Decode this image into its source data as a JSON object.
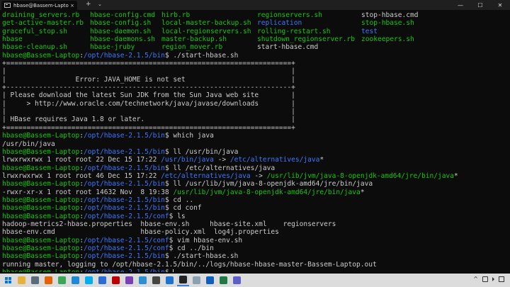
{
  "window": {
    "tab_title": "hbase@Bassem-Laptop: /opt/hl",
    "tab_close": "×",
    "new_tab": "+",
    "dropdown": "⌄",
    "minimize": "—",
    "maximize": "☐",
    "close": "✕"
  },
  "terminal": {
    "file_grid": [
      [
        "draining_servers.rb",
        "hbase-config.cmd",
        "hirb.rb",
        "regionservers.sh",
        "stop-hbase.cmd"
      ],
      [
        "get-active-master.rb",
        "hbase-config.sh",
        "local-master-backup.sh",
        "replication",
        "stop-hbase.sh"
      ],
      [
        "graceful_stop.sh",
        "hbase-daemon.sh",
        "local-regionservers.sh",
        "rolling-restart.sh",
        "test"
      ],
      [
        "hbase",
        "hbase-daemons.sh",
        "master-backup.sh",
        "shutdown_regionserver.rb",
        "zookeepers.sh"
      ],
      [
        "hbase-cleanup.sh",
        "hbase-jruby",
        "region_mover.rb",
        "start-hbase.cmd",
        ""
      ]
    ],
    "prompt_user": "hbase@Bassem-Laptop",
    "prompt_sep": ":",
    "prompt_bin": "/opt/hbase-2.1.5/bin",
    "prompt_conf": "/opt/hbase-2.1.5/conf",
    "prompt_end": "$",
    "cmd_start": " ./start-hbase.sh",
    "box_border": "+======================================================================+",
    "box_blank": "|                                                                      |",
    "box_error": "|                 Error: JAVA_HOME is not set                          |",
    "box_sep": "+----------------------------------------------------------------------+",
    "box_download": "| Please download the latest Sun JDK from the Sun Java web site        |",
    "box_url": "|     > http://www.oracle.com/technetwork/java/javase/downloads        |",
    "box_blank2": "|                                                                      |",
    "box_requires": "| HBase requires Java 1.8 or later.                                    |",
    "cmd_which": " which java",
    "out_which": "/usr/bin/java",
    "cmd_ll1": " ll /usr/bin/java",
    "ll1_prefix": "lrwxrwxrwx 1 root root 22 Dec 15 17:22 ",
    "ll1_link": "/usr/bin/java",
    "ll1_arrow": " -> ",
    "ll1_target": "/etc/alternatives/java",
    "ll1_star": "*",
    "cmd_ll2": " ll /etc/alternatives/java",
    "ll2_prefix": "lrwxrwxrwx 1 root root 46 Dec 15 17:22 ",
    "ll2_link": "/etc/alternatives/java",
    "ll2_arrow": " -> ",
    "ll2_target": "/usr/lib/jvm/java-8-openjdk-amd64/jre/bin/java",
    "ll2_star": "*",
    "cmd_ll3": " ll /usr/lib/jvm/java-8-openjdk-amd64/jre/bin/java",
    "ll3_prefix": "-rwxr-xr-x 1 root root 14632 Nov  8 19:38 ",
    "ll3_target": "/usr/lib/jvm/java-8-openjdk-amd64/jre/bin/java",
    "ll3_star": "*",
    "cmd_cd": " cd ..",
    "cmd_cdconf": " cd conf",
    "cmd_ls": " ls",
    "ls_row1": "hadoop-metrics2-hbase.properties  hbase-env.sh     hbase-site.xml    regionservers",
    "ls_row2": "hbase-env.cmd                     hbase-policy.xml  log4j.properties",
    "cmd_vim": " vim hbase-env.sh",
    "cmd_cdbin": " cd ../bin",
    "cmd_start2": " ./start-hbase.sh",
    "out_running": "running master, logging to /opt/hbase-2.1.5/bin/../logs/hbase-hbase-master-Bassem-Laptop.out"
  },
  "taskbar": {
    "icons": [
      {
        "name": "file-explorer-icon",
        "color": "#e8b23a",
        "active": false
      },
      {
        "name": "store-icon",
        "color": "#5a6b7a",
        "active": false
      },
      {
        "name": "firefox-icon",
        "color": "#e66000",
        "active": false
      },
      {
        "name": "chrome-icon",
        "color": "#3aa757",
        "active": false
      },
      {
        "name": "edge-icon",
        "color": "#1e8ad6",
        "active": false
      },
      {
        "name": "skype-icon",
        "color": "#00aff0",
        "active": false
      },
      {
        "name": "maps-icon",
        "color": "#2b6cd6",
        "active": false
      },
      {
        "name": "filezilla-icon",
        "color": "#bf0000",
        "active": false
      },
      {
        "name": "visual-studio-icon",
        "color": "#7b3fb8",
        "active": false
      },
      {
        "name": "vscode-icon",
        "color": "#2b8fd6",
        "active": false
      },
      {
        "name": "app-icon",
        "color": "#444444",
        "active": false
      },
      {
        "name": "teamviewer-icon",
        "color": "#1d72d3",
        "active": false
      },
      {
        "name": "terminal-icon",
        "color": "#222222",
        "active": true
      },
      {
        "name": "notepad-icon",
        "color": "#8aa1b1",
        "active": false
      },
      {
        "name": "outlook-icon",
        "color": "#0f5fbf",
        "active": false
      },
      {
        "name": "excel-icon",
        "color": "#1d7a44",
        "active": false
      },
      {
        "name": "teams-icon",
        "color": "#5b5fc7",
        "active": false
      }
    ],
    "tray_chevron": "^",
    "tray_network": "network-icon",
    "tray_volume": "volume-icon",
    "tray_notifications": "notifications-icon"
  }
}
